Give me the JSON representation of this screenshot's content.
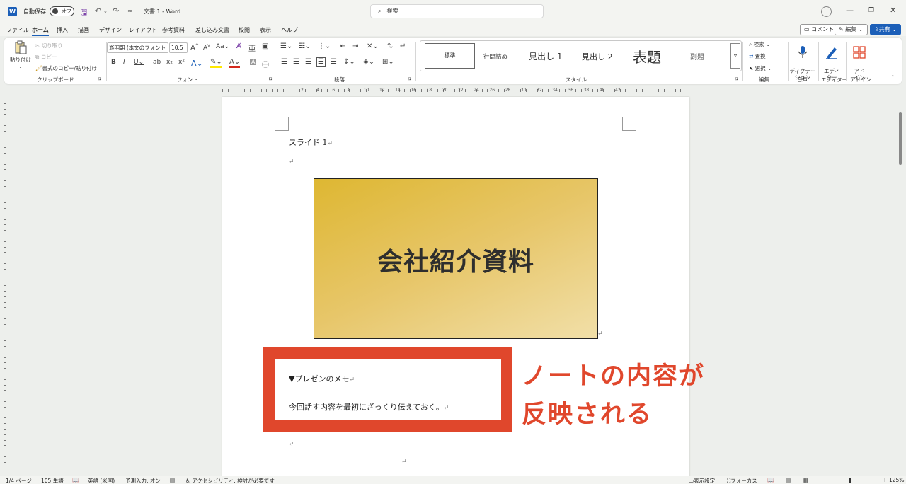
{
  "titlebar": {
    "autosave_label": "自動保存",
    "autosave_state": "オフ",
    "doc_title": "文書 1  -  Word",
    "search_placeholder": "検索"
  },
  "menu": {
    "tabs": [
      "ファイル",
      "ホーム",
      "挿入",
      "描画",
      "デザイン",
      "レイアウト",
      "参考資料",
      "差し込み文書",
      "校閲",
      "表示",
      "ヘルプ"
    ],
    "comment_button": "コメント",
    "edit_button": "編集",
    "share_button": "共有"
  },
  "ribbon": {
    "clipboard": {
      "paste": "貼り付け",
      "cut": "切り取り",
      "copy": "コピー",
      "format_painter": "書式のコピー/貼り付け",
      "label": "クリップボード"
    },
    "font": {
      "font_name": "游明朝 (本文のフォント",
      "font_size": "10.5",
      "label": "フォント"
    },
    "paragraph": {
      "label": "段落"
    },
    "styles": {
      "items": [
        "標準",
        "行間詰め",
        "見出し 1",
        "見出し 2",
        "表題",
        "副題"
      ],
      "label": "スタイル"
    },
    "editing": {
      "find": "検索",
      "replace": "置換",
      "select": "選択",
      "label": "編集"
    },
    "voice": {
      "dictate": "ディクテー\nション",
      "label": "音声"
    },
    "editor": {
      "name": "エディ\nター",
      "label": "エディター"
    },
    "addins": {
      "name": "アド\nイン",
      "label": "アドイン"
    }
  },
  "ruler": {
    "numbers": [
      "2",
      "4",
      "6",
      "8",
      "10",
      "12",
      "14",
      "16",
      "18",
      "20",
      "22",
      "24",
      "26",
      "28",
      "30",
      "32",
      "34",
      "36",
      "38",
      "40",
      "42"
    ]
  },
  "document": {
    "heading": "スライド 1",
    "slide_title": "会社紹介資料",
    "note_title": "▼プレゼンのメモ",
    "note_body": "今回話す内容を最初にざっくり伝えておく。",
    "para_mark": "↵"
  },
  "annotation": {
    "line1": "ノートの内容が",
    "line2": "反映される",
    "color": "#e0472c"
  },
  "statusbar": {
    "page": "1/4 ページ",
    "words": "105 単語",
    "language": "英語 (米国)",
    "predictive": "予測入力: オン",
    "accessibility": "アクセシビリティ: 検討が必要です",
    "display_settings": "表示設定",
    "focus": "フォーカス",
    "zoom": "125%"
  }
}
